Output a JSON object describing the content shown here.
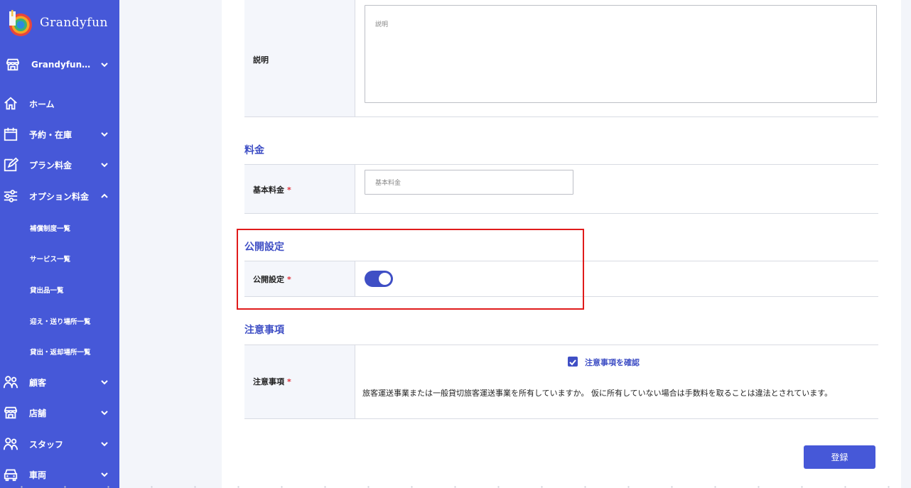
{
  "app": {
    "logo_text": "Grandyfun",
    "colors": {
      "sidebar": "#4658d8",
      "accent": "#3f4fc5",
      "required": "#e0303a",
      "highlight": "#e01b1b"
    }
  },
  "sidebar": {
    "store_selector": {
      "label": "Grandyfun…",
      "icon": "store-icon"
    },
    "items": [
      {
        "label": "ホーム",
        "icon": "home-icon"
      },
      {
        "label": "予約・在庫",
        "icon": "calendar-icon"
      },
      {
        "label": "プラン料金",
        "icon": "edit-icon"
      },
      {
        "label": "オプション料金",
        "icon": "sliders-icon"
      },
      {
        "label": "顧客",
        "icon": "users-icon"
      },
      {
        "label": "店舗",
        "icon": "store-icon"
      },
      {
        "label": "スタッフ",
        "icon": "users-icon"
      },
      {
        "label": "車両",
        "icon": "car-icon"
      }
    ],
    "sub_items": [
      "補償制度一覧",
      "サービス一覧",
      "貸出品一覧",
      "迎え・送り場所一覧",
      "貸出・返却場所一覧"
    ]
  },
  "form": {
    "description": {
      "label": "説明",
      "placeholder": "説明"
    },
    "pricing": {
      "section_title": "料金",
      "label": "基本料金",
      "required": "*",
      "placeholder": "基本料金"
    },
    "publish": {
      "section_title": "公開設定",
      "label": "公開設定",
      "required": "*",
      "toggle_on": true
    },
    "notes": {
      "section_title": "注意事項",
      "label": "注意事項",
      "required": "*",
      "checkbox_label": "注意事項を確認",
      "checked": true,
      "text": "旅客運送事業または一般貸切旅客運送事業を所有していますか。 仮に所有していない場合は手数料を取ることは違法とされています。"
    },
    "submit_label": "登録"
  }
}
